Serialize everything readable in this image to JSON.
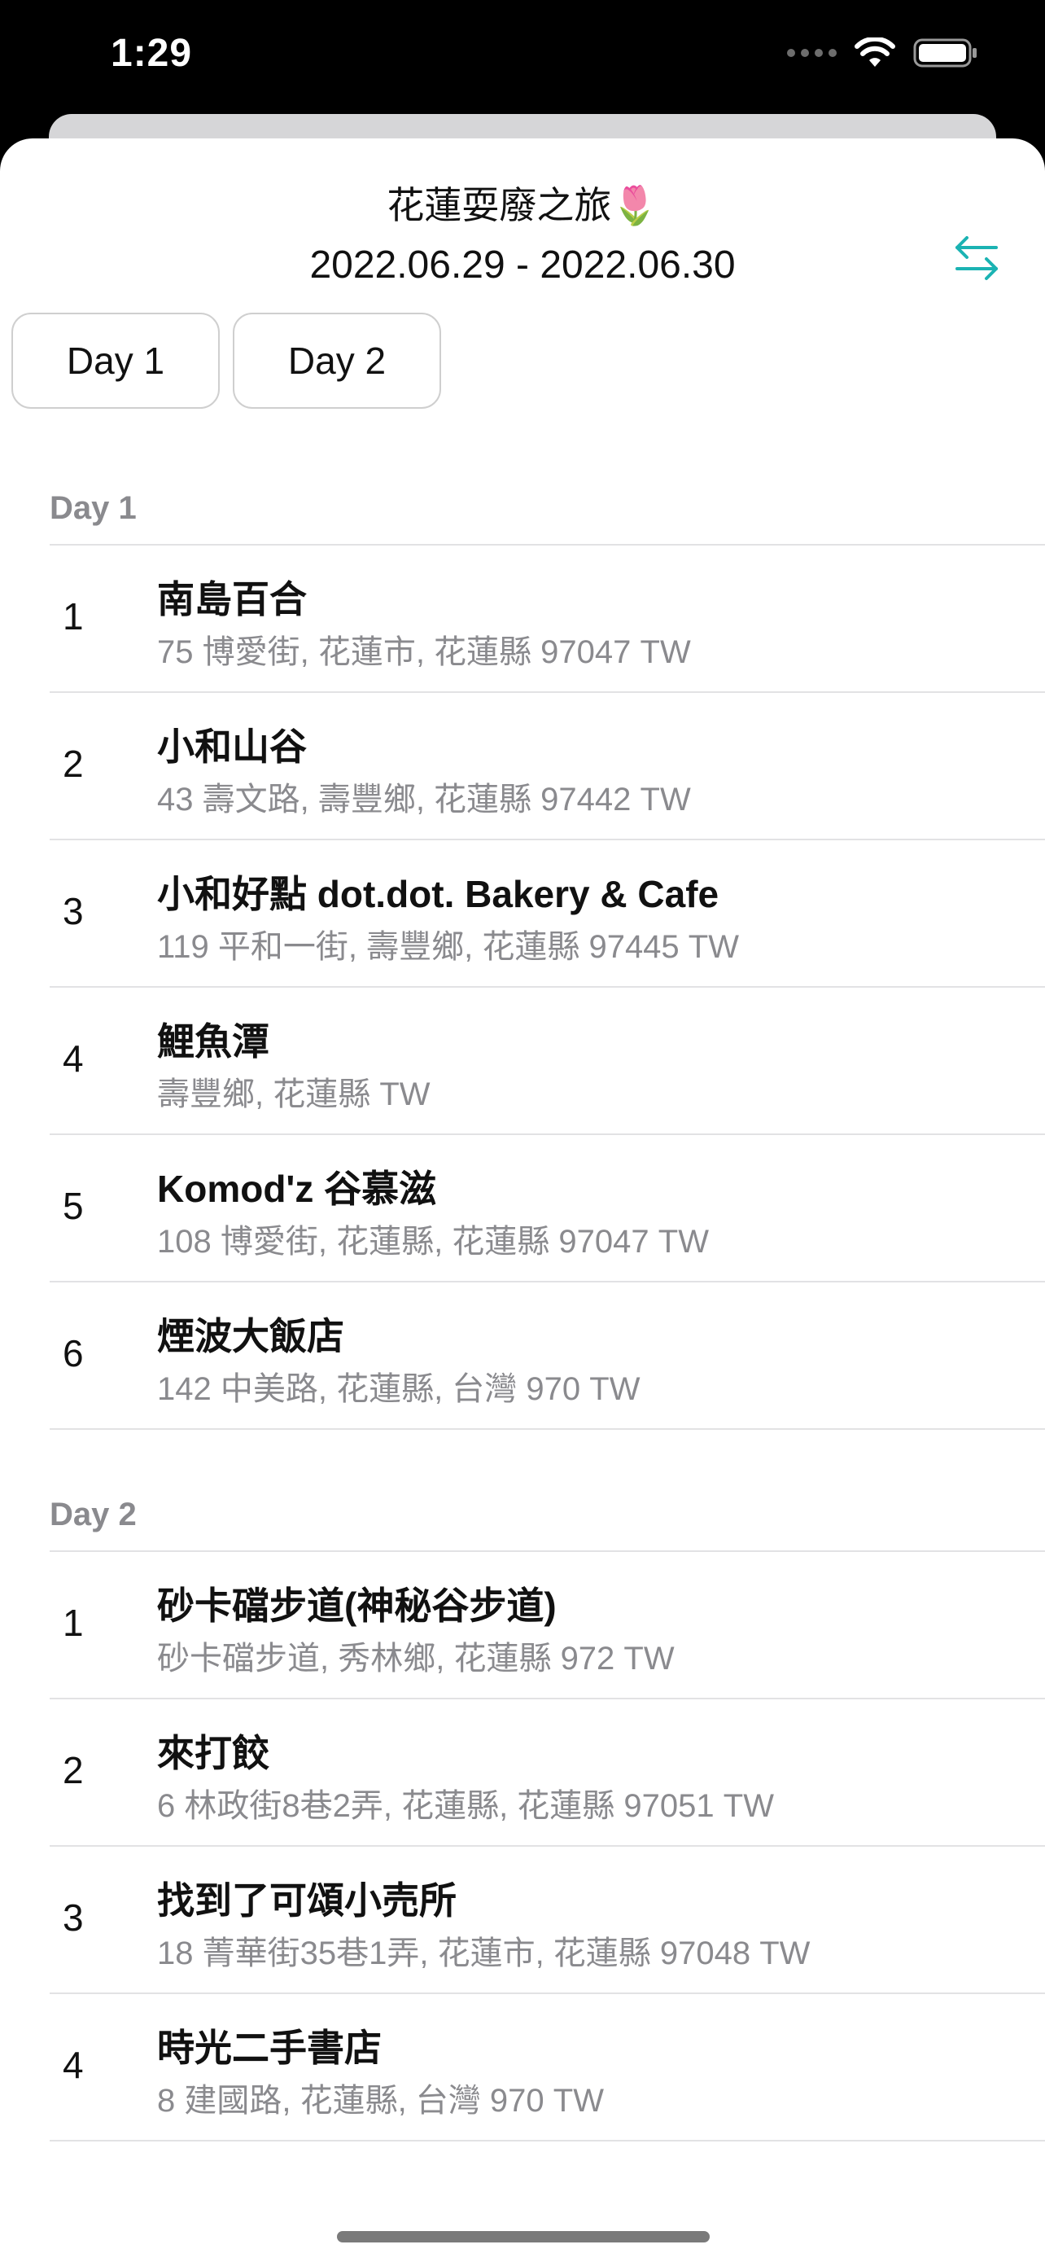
{
  "status_bar": {
    "time": "1:29"
  },
  "header": {
    "title": "花蓮耍廢之旅🌷",
    "date_range": "2022.06.29 - 2022.06.30"
  },
  "tabs": [
    {
      "label": "Day 1"
    },
    {
      "label": "Day 2"
    }
  ],
  "sections": [
    {
      "header": "Day 1",
      "items": [
        {
          "index": "1",
          "title": "南島百合",
          "address": "75 博愛街, 花蓮市, 花蓮縣 97047 TW"
        },
        {
          "index": "2",
          "title": "小和山谷",
          "address": "43 壽文路, 壽豐鄉, 花蓮縣 97442 TW"
        },
        {
          "index": "3",
          "title": "小和好點 dot.dot. Bakery & Cafe",
          "address": "119 平和一街, 壽豐鄉, 花蓮縣 97445 TW"
        },
        {
          "index": "4",
          "title": "鯉魚潭",
          "address": "壽豐鄉, 花蓮縣 TW"
        },
        {
          "index": "5",
          "title": "Komod'z 谷慕滋",
          "address": "108 博愛街, 花蓮縣, 花蓮縣 97047 TW"
        },
        {
          "index": "6",
          "title": "煙波大飯店",
          "address": "142 中美路, 花蓮縣, 台灣 970 TW"
        }
      ]
    },
    {
      "header": "Day 2",
      "items": [
        {
          "index": "1",
          "title": "砂卡礑步道(神秘谷步道)",
          "address": "砂卡礑步道, 秀林鄉, 花蓮縣 972 TW"
        },
        {
          "index": "2",
          "title": "來打餃",
          "address": "6 林政街8巷2弄, 花蓮縣, 花蓮縣 97051 TW"
        },
        {
          "index": "3",
          "title": "找到了可頌小売所",
          "address": "18 菁華街35巷1弄, 花蓮市, 花蓮縣 97048 TW"
        },
        {
          "index": "4",
          "title": "時光二手書店",
          "address": "8 建國路, 花蓮縣, 台灣 970 TW"
        }
      ]
    }
  ],
  "icons": {
    "swap": "swap-arrows-icon",
    "wifi": "wifi-icon",
    "battery": "battery-icon",
    "signal": "cellular-signal-icon"
  },
  "colors": {
    "accent": "#1bb3b3",
    "secondary_text": "#8a8a8e",
    "divider": "#e2e2e4"
  }
}
